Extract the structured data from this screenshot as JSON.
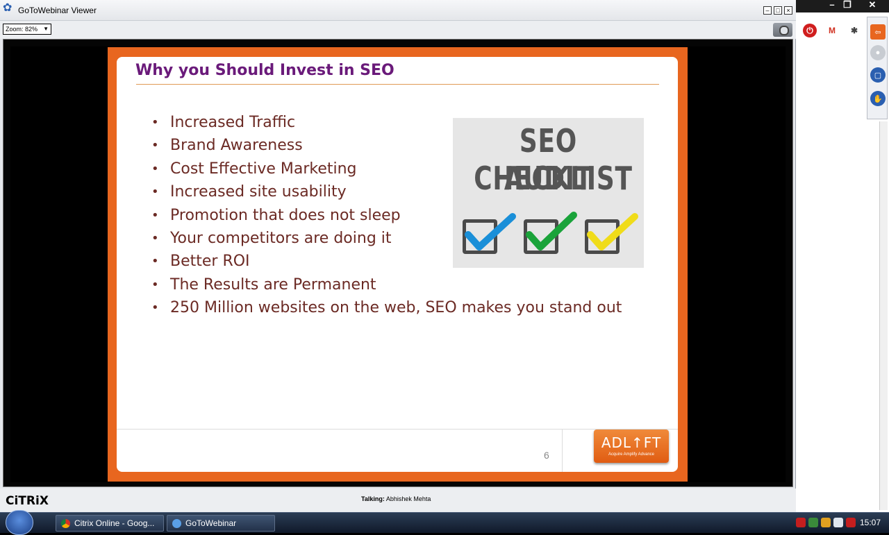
{
  "window": {
    "title": "GoToWebinar Viewer",
    "minimize": "–",
    "maximize": "□",
    "close": "×"
  },
  "desktop_controls": {
    "minimize": "–",
    "restore": "❐",
    "close": "✕"
  },
  "toolbar": {
    "zoom_label": "Zoom: 82%",
    "zoom_arrow": "▼"
  },
  "slide": {
    "title": "Why you Should Invest in SEO",
    "bullets": [
      "Increased Traffic",
      "Brand Awareness",
      "Cost Effective Marketing",
      "Increased site usability",
      "Promotion that does not sleep",
      "Your competitors are doing it",
      "Better ROI",
      "The Results are Permanent",
      "250 Million websites on the web, SEO makes you stand out"
    ],
    "image": {
      "line1": "SEO AUDIT",
      "line2": "CHECKLIST",
      "checks": [
        {
          "color": "#1a8fd8"
        },
        {
          "color": "#1aa33a"
        },
        {
          "color": "#f0dc1a"
        }
      ]
    },
    "page_number": "6",
    "logo": {
      "main": "ADL↑FT",
      "sub": "Acquire  Amplify  Advance"
    },
    "colors": {
      "frame": "#e8661f",
      "title": "#6a1a7a",
      "bullet_text": "#6b2a24"
    }
  },
  "footer": {
    "brand": "CiTRiX",
    "talking_label": "Talking:",
    "talking_name": "Abhishek Mehta"
  },
  "taskbar": {
    "items": [
      {
        "label": "Citrix Online - Goog..."
      },
      {
        "label": "GoToWebinar"
      }
    ],
    "clock": "15:07"
  }
}
